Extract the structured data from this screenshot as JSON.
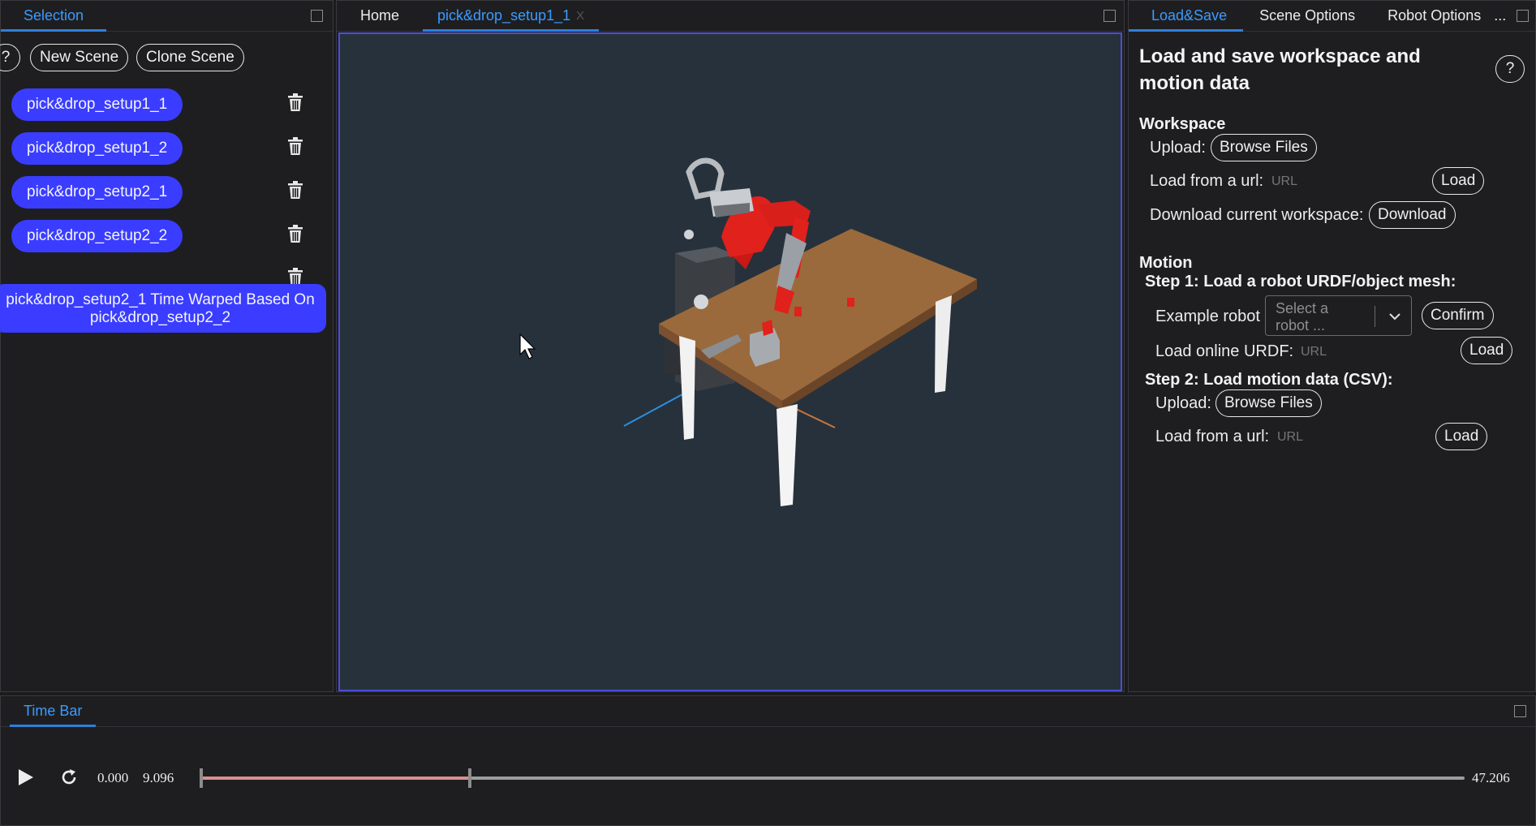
{
  "left_panel": {
    "tab_label": "Selection",
    "help_label": "?",
    "new_scene_label": "New Scene",
    "clone_scene_label": "Clone Scene",
    "scenes": [
      {
        "label": "pick&drop_setup1_1"
      },
      {
        "label": "pick&drop_setup1_2"
      },
      {
        "label": "pick&drop_setup2_1"
      },
      {
        "label": "pick&drop_setup2_2"
      }
    ],
    "warped_scene": "pick&drop_setup2_1 Time Warped Based On pick&drop_setup2_2"
  },
  "center_panel": {
    "tabs": [
      {
        "label": "Home"
      },
      {
        "label": "pick&drop_setup1_1",
        "close": "X"
      }
    ]
  },
  "right_panel": {
    "tabs": [
      {
        "label": "Load&Save"
      },
      {
        "label": "Scene Options"
      },
      {
        "label": "Robot Options"
      }
    ],
    "overflow_label": "...",
    "title": "Load and save workspace and motion data",
    "help_label": "?",
    "workspace": {
      "heading": "Workspace",
      "upload_label": "Upload:",
      "browse_label": "Browse Files",
      "url_label": "Load from a url:",
      "url_placeholder": "URL",
      "load_label": "Load",
      "download_text": "Download current workspace:",
      "download_label": "Download"
    },
    "motion": {
      "heading": "Motion",
      "step1": "Step 1: Load a robot URDF/object mesh:",
      "example_robot_label": "Example robot",
      "select_placeholder": "Select a robot ...",
      "confirm_label": "Confirm",
      "urdf_label": "Load online URDF:",
      "urdf_placeholder": "URL",
      "urdf_load_label": "Load",
      "step2": "Step 2: Load motion data (CSV):",
      "upload_label": "Upload:",
      "browse_label": "Browse Files",
      "url_label": "Load from a url:",
      "url_placeholder": "URL",
      "load_label": "Load"
    }
  },
  "time_bar": {
    "tab_label": "Time Bar",
    "start_time": "0.000",
    "current_time": "9.096",
    "end_time": "47.206",
    "progress_fraction": 0.2134
  },
  "colors": {
    "accent": "#3b9bff",
    "scene_pill": "#3a3dff",
    "viewport_bg": "#27313b",
    "viewport_border": "#4a4fd6",
    "robot_red": "#e0211c",
    "table_wood": "#9a6a3c",
    "track_played": "#d98f8f"
  }
}
